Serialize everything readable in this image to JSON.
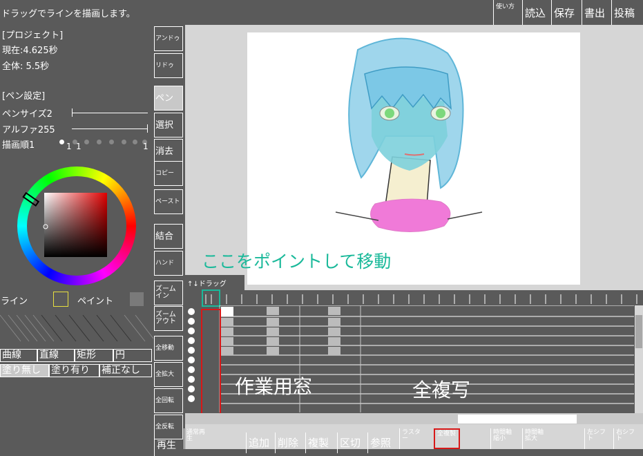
{
  "topbar": {
    "hint": "ドラッグでラインを描画します。",
    "buttons": [
      {
        "id": "howto",
        "label": "使い方"
      },
      {
        "id": "load",
        "label": "読込"
      },
      {
        "id": "save",
        "label": "保存"
      },
      {
        "id": "export",
        "label": "書出"
      },
      {
        "id": "post",
        "label": "投稿"
      }
    ]
  },
  "project": {
    "heading": "[プロジェクト]",
    "current": "現在:4.625秒",
    "total": "全体: 5.5秒"
  },
  "pen": {
    "heading": "[ペン設定]",
    "size": "ペンサイズ2",
    "alpha": "アルファ255",
    "order": "描画順1",
    "order_marks": [
      "1",
      "1",
      "1"
    ]
  },
  "color": {
    "line_label": "ライン",
    "paint_label": "ペイント",
    "line_color": "#5a5a5a",
    "paint_color": "#7a7a7a",
    "line_border": "#e8e040"
  },
  "shape_modes": [
    "曲線",
    "直線",
    "矩形",
    "円"
  ],
  "fill_modes": [
    "塗り無し",
    "塗り有り",
    "補正なし"
  ],
  "tools": [
    {
      "id": "undo",
      "label": "アンドゥ"
    },
    {
      "id": "redo",
      "label": "リドゥ"
    },
    {
      "id": "pen",
      "label": "ペン"
    },
    {
      "id": "select",
      "label": "選択"
    },
    {
      "id": "erase",
      "label": "消去"
    },
    {
      "id": "copy",
      "label": "コピー"
    },
    {
      "id": "paste",
      "label": "ペースト"
    },
    {
      "id": "merge",
      "label": "結合"
    },
    {
      "id": "hand",
      "label": "ハンド"
    },
    {
      "id": "zoomin",
      "label": "ズーム\nイン"
    },
    {
      "id": "zoomout",
      "label": "ズーム\nアウト"
    },
    {
      "id": "moveall",
      "label": "全移動"
    },
    {
      "id": "scaleall",
      "label": "全拡大"
    },
    {
      "id": "rotateall",
      "label": "全回転"
    },
    {
      "id": "flipall",
      "label": "全反転"
    }
  ],
  "timeline": {
    "drag_label": "↑↓ドラッグ",
    "annotation_point": "ここをポイントして移動",
    "annotation_window": "作業用窓",
    "annotation_copy": "全複写"
  },
  "bottom_buttons": [
    {
      "id": "play",
      "label": "再生"
    },
    {
      "id": "playnormal",
      "label": "通常再\n生"
    },
    {
      "id": "add",
      "label": "追加"
    },
    {
      "id": "delete",
      "label": "削除"
    },
    {
      "id": "dup",
      "label": "複製"
    },
    {
      "id": "split",
      "label": "区切"
    },
    {
      "id": "ref",
      "label": "参照"
    },
    {
      "id": "raster",
      "label": "ラスタ\nー"
    },
    {
      "id": "alldup",
      "label": "全複製"
    },
    {
      "id": "shrink",
      "label": "時間軸\n縮小"
    },
    {
      "id": "expand",
      "label": "時間軸\n拡大"
    },
    {
      "id": "lshift",
      "label": "左シフ\nト"
    },
    {
      "id": "rshift",
      "label": "右シフ\nト"
    }
  ],
  "colors": {
    "background": "#5a5a5a",
    "canvas_area": "#d6d6d6",
    "annotation_teal": "#1ab99a",
    "highlight_red": "#d81818"
  }
}
